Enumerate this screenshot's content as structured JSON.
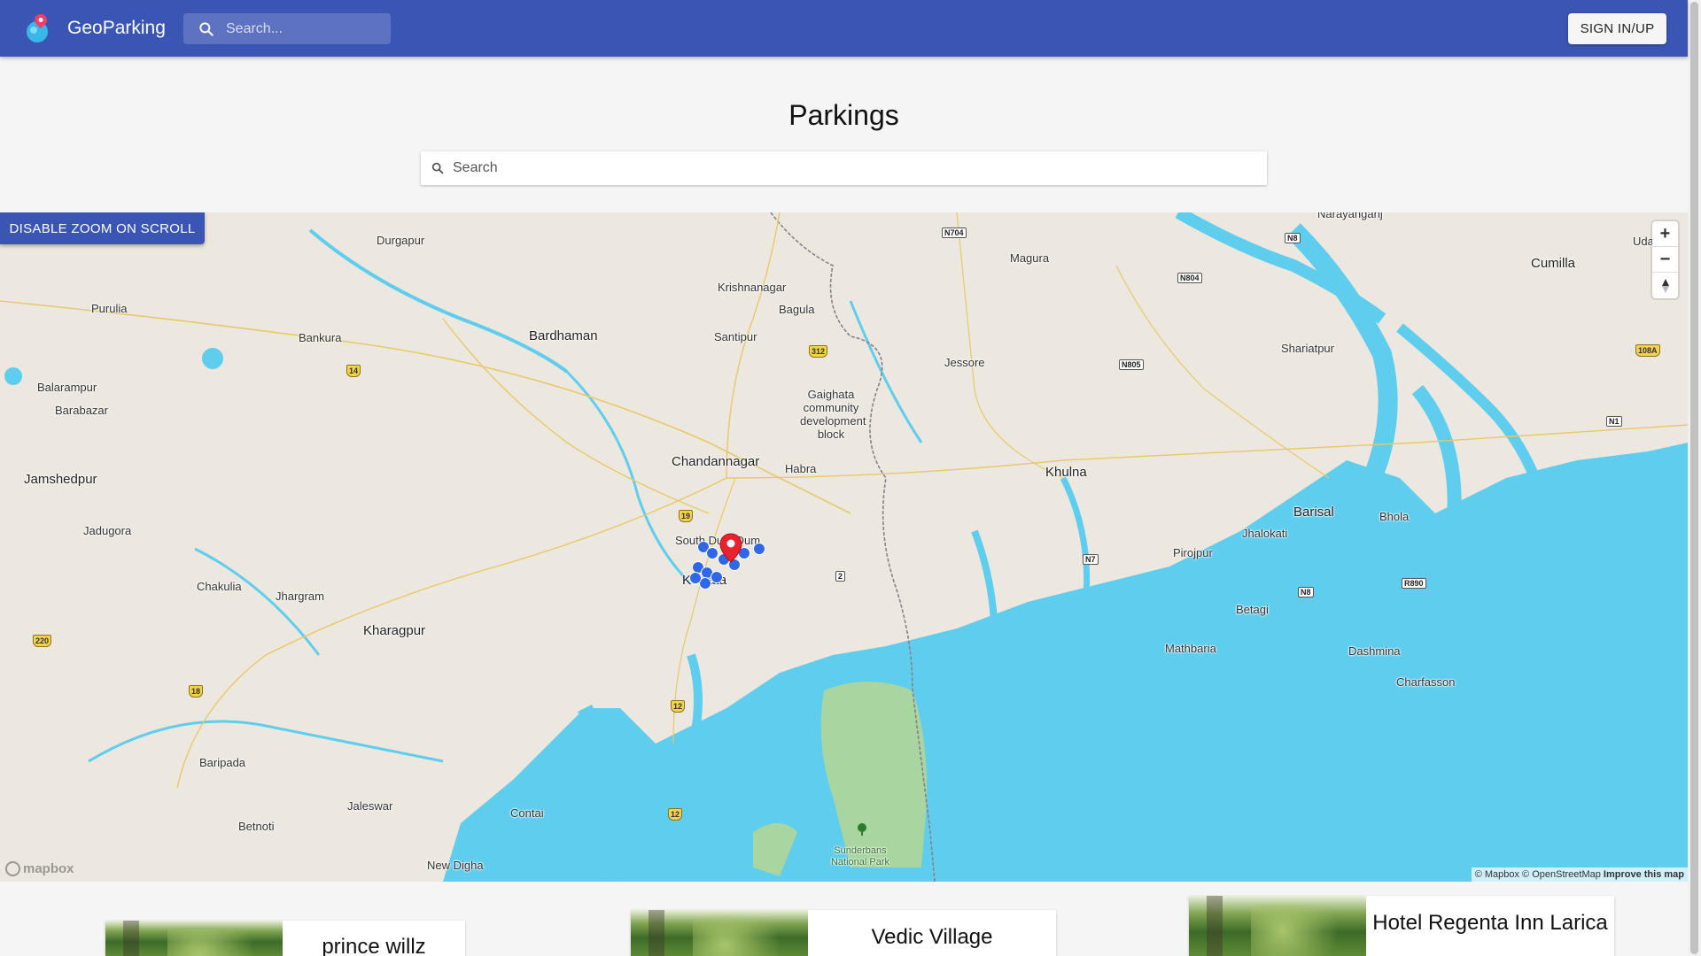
{
  "app": {
    "brand": "GeoParking",
    "search_placeholder": "Search...",
    "signin_label": "SIGN IN/UP"
  },
  "page": {
    "title": "Parkings",
    "search_placeholder": "Search"
  },
  "map": {
    "zoom_toggle_label": "DISABLE ZOOM ON SCROLL",
    "zoom_in": "+",
    "zoom_out": "−",
    "compass": "▲",
    "attribution_prefix": "© Mapbox © OpenStreetMap",
    "attribution_link": "Improve this map",
    "logo": "mapbox",
    "places": [
      {
        "name": "Durgapur",
        "size": "normal"
      },
      {
        "name": "Purulia",
        "size": "normal"
      },
      {
        "name": "Bankura",
        "size": "normal"
      },
      {
        "name": "Bardhaman",
        "size": "big"
      },
      {
        "name": "Krishnanagar",
        "size": "normal"
      },
      {
        "name": "Bagula",
        "size": "normal"
      },
      {
        "name": "Santipur",
        "size": "normal"
      },
      {
        "name": "Magura",
        "size": "normal"
      },
      {
        "name": "Narayanganj",
        "size": "normal"
      },
      {
        "name": "Cumilla",
        "size": "big"
      },
      {
        "name": "Udai",
        "size": "normal"
      },
      {
        "name": "Balarampur",
        "size": "normal"
      },
      {
        "name": "Barabazar",
        "size": "normal"
      },
      {
        "name": "Jamshedpur",
        "size": "big"
      },
      {
        "name": "Gaighata community development block",
        "size": "normal"
      },
      {
        "name": "Jessore",
        "size": "normal"
      },
      {
        "name": "Shariatpur",
        "size": "normal"
      },
      {
        "name": "Chandannagar",
        "size": "big"
      },
      {
        "name": "Habra",
        "size": "normal"
      },
      {
        "name": "Khulna",
        "size": "big"
      },
      {
        "name": "Barisal",
        "size": "big"
      },
      {
        "name": "Bhola",
        "size": "normal"
      },
      {
        "name": "Jhalokati",
        "size": "normal"
      },
      {
        "name": "Jadugora",
        "size": "normal"
      },
      {
        "name": "South Dum Dum",
        "size": "normal"
      },
      {
        "name": "Kolkata",
        "size": "big"
      },
      {
        "name": "Pirojpur",
        "size": "normal"
      },
      {
        "name": "Chakulia",
        "size": "normal"
      },
      {
        "name": "Jhargram",
        "size": "normal"
      },
      {
        "name": "Kharagpur",
        "size": "big"
      },
      {
        "name": "Betagi",
        "size": "normal"
      },
      {
        "name": "Mathbaria",
        "size": "normal"
      },
      {
        "name": "Dashmina",
        "size": "normal"
      },
      {
        "name": "Charfasson",
        "size": "normal"
      },
      {
        "name": "Baripada",
        "size": "normal"
      },
      {
        "name": "Jaleswar",
        "size": "normal"
      },
      {
        "name": "Contai",
        "size": "normal"
      },
      {
        "name": "Betnoti",
        "size": "normal"
      },
      {
        "name": "New Digha",
        "size": "normal"
      },
      {
        "name": "Sunderbans National Park",
        "size": "park"
      }
    ],
    "shields": [
      "14",
      "312",
      "19",
      "220",
      "18",
      "12",
      "12",
      "108A"
    ],
    "national_shields": [
      "N704",
      "N8",
      "N804",
      "N805",
      "N1",
      "N7",
      "N8",
      "R890",
      "2"
    ]
  },
  "cards": [
    {
      "title": "prince willz"
    },
    {
      "title": "Vedic Village"
    },
    {
      "title": "Hotel Regenta Inn Larica"
    }
  ],
  "colors": {
    "primary": "#3a55b4",
    "water": "#5fcdee",
    "land": "#ece8df",
    "marker_red": "#e8222e",
    "marker_blue": "#2f67e6"
  }
}
